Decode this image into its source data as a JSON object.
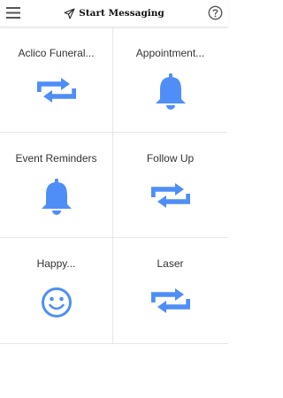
{
  "header": {
    "title": "Start Messaging",
    "menu_icon": "hamburger-menu-icon",
    "title_icon": "paper-plane-icon",
    "help_icon": "help-circle-icon"
  },
  "colors": {
    "accent": "#4f8ef7",
    "divider": "#e6e6e6",
    "text": "#333333"
  },
  "tiles": [
    {
      "label": "Aclico Funeral...",
      "icon": "repeat-icon"
    },
    {
      "label": "Appointment...",
      "icon": "bell-icon"
    },
    {
      "label": "Event Reminders",
      "icon": "bell-icon"
    },
    {
      "label": "Follow Up",
      "icon": "repeat-icon"
    },
    {
      "label": "Happy...",
      "icon": "smiley-icon"
    },
    {
      "label": "Laser",
      "icon": "repeat-icon"
    }
  ]
}
